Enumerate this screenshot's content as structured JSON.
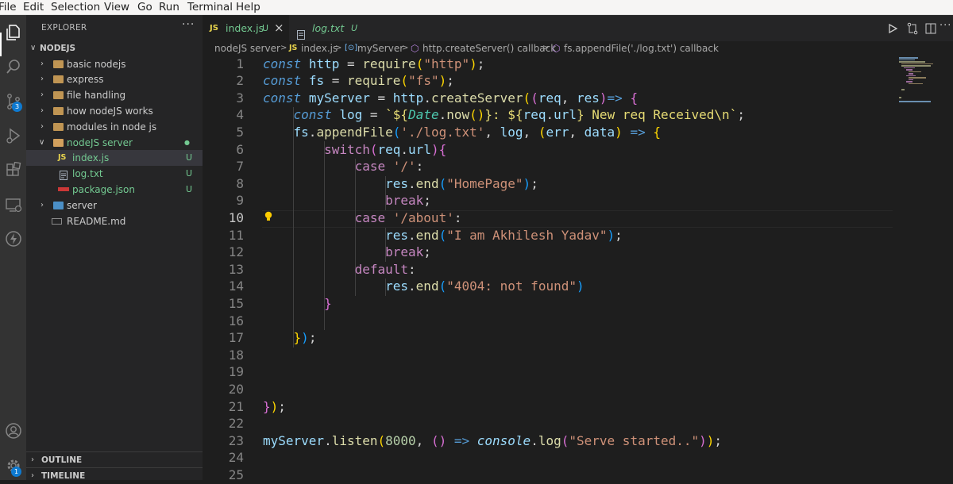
{
  "menu": [
    "File",
    "Edit",
    "Selection",
    "View",
    "Go",
    "Run",
    "Terminal",
    "Help"
  ],
  "activity": {
    "source_control_badge": "3",
    "accounts_badge": "1"
  },
  "explorer": {
    "title": "EXPLORER",
    "more": "···",
    "root": "NODEJS",
    "items": [
      {
        "label": "basic nodejs",
        "badge": ""
      },
      {
        "label": "express",
        "badge": ""
      },
      {
        "label": "file handling",
        "badge": ""
      },
      {
        "label": "how nodeJS works",
        "badge": ""
      },
      {
        "label": "modules in node js",
        "badge": ""
      },
      {
        "label": "nodeJS server",
        "badge": "●"
      },
      {
        "label": "index.js",
        "badge": "U",
        "icon": "JS"
      },
      {
        "label": "log.txt",
        "badge": "U"
      },
      {
        "label": "package.json",
        "badge": "U"
      },
      {
        "label": "server",
        "badge": ""
      },
      {
        "label": "README.md",
        "badge": ""
      }
    ],
    "outline": "OUTLINE",
    "timeline": "TIMELINE"
  },
  "tabs": [
    {
      "icon": "JS",
      "label": "index.js",
      "status": "U",
      "close": "×"
    },
    {
      "label": "log.txt",
      "status": "U"
    }
  ],
  "breadcrumb": {
    "folder": "nodeJS server",
    "file_icon": "JS",
    "file": "index.js",
    "symbol1": "myServer",
    "symbol2": "http.createServer() callback",
    "symbol3": "fs.appendFile('./log.txt') callback",
    "sep": ">"
  },
  "editor": {
    "current_line": 10,
    "line_numbers": [
      "1",
      "2",
      "3",
      "4",
      "5",
      "6",
      "7",
      "8",
      "9",
      "10",
      "11",
      "12",
      "13",
      "14",
      "15",
      "16",
      "17",
      "18",
      "19",
      "20",
      "21",
      "22",
      "23",
      "24",
      "25"
    ]
  },
  "colors": {
    "keyword": "#c586c0",
    "storage": "#569cd6",
    "variable": "#9cdcfe",
    "function": "#dcdcaa",
    "string": "#ce9178",
    "accent": "#0e7ad1",
    "untracked": "#73c991"
  }
}
